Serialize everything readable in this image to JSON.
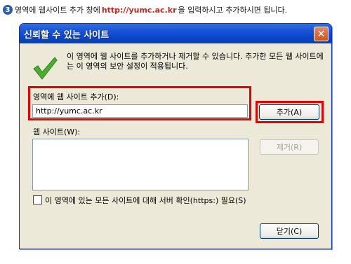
{
  "instruction": {
    "step": "3",
    "before": "영역에 웹사이트 추가 창에",
    "url": "http://yumc.ac.kr",
    "after": "을 입력하시고 추가하시면 됩니다."
  },
  "dialog": {
    "title": "신뢰할 수 있는 사이트",
    "close_glyph": "✕",
    "info": "이 영역에 웹 사이트를 추가하거나 제거할 수 있습니다. 추가한 모든 웹 사이트에는 이 영역의 보안 설정이 적용됩니다.",
    "add_label": "영역에 웹 사이트 추가(D):",
    "site_input_value": "http://yumc.ac.kr",
    "add_button": "추가(A)",
    "websites_label": "웹 사이트(W):",
    "remove_button": "제거(R)",
    "https_label": "이 영역에 있는 모든 사이트에 대해 서버 확인(https:) 필요(S)",
    "https_checked": false,
    "close_button": "닫기(C)",
    "icons": [
      "checkmark-icon",
      "close-icon"
    ],
    "colors": {
      "highlight": "#e60000",
      "titlebar": "#0847c8",
      "url": "#c0281e"
    }
  }
}
